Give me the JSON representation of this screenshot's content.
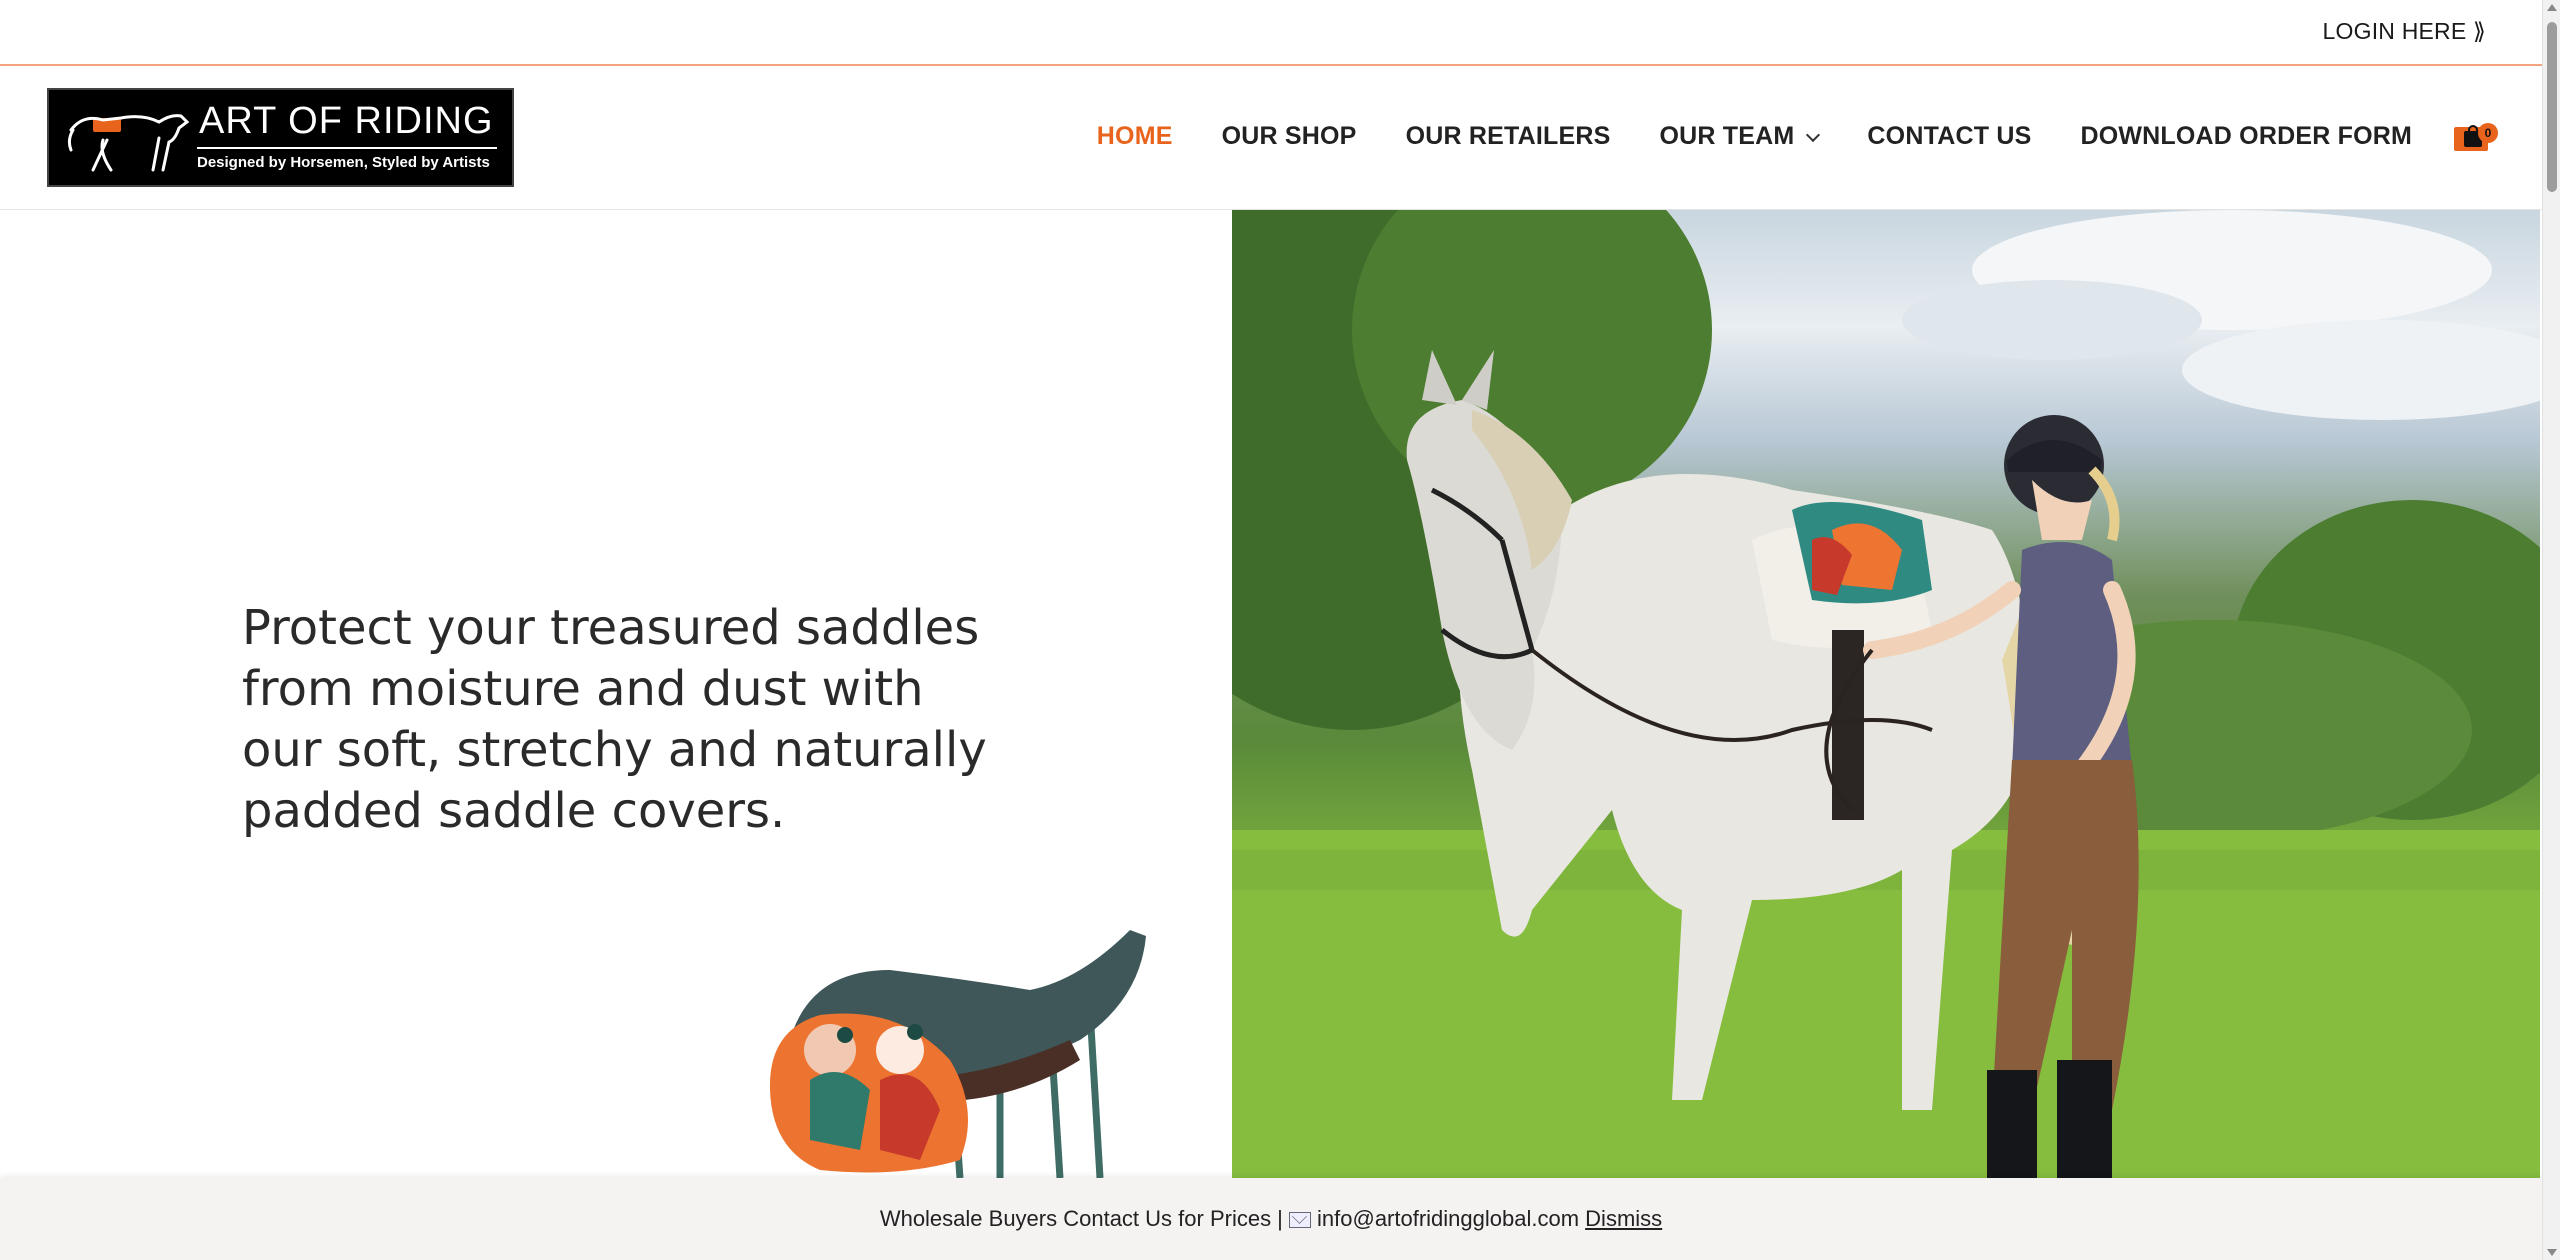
{
  "topbar": {
    "login_label": "LOGIN HERE ⟫"
  },
  "logo": {
    "title": "ART OF RIDING",
    "tagline": "Designed by Horsemen, Styled by Artists"
  },
  "nav": {
    "items": [
      {
        "label": "HOME",
        "active": true
      },
      {
        "label": "OUR SHOP",
        "active": false
      },
      {
        "label": "OUR RETAILERS",
        "active": false
      },
      {
        "label": "OUR TEAM",
        "active": false,
        "has_dropdown": true
      },
      {
        "label": "CONTACT US",
        "active": false
      },
      {
        "label": "DOWNLOAD ORDER FORM",
        "active": false
      }
    ]
  },
  "cart": {
    "icon": "shopping-bag-icon",
    "count": "0"
  },
  "hero": {
    "headline": "Protect your treasured saddles from moisture and dust with our soft, stretchy and naturally padded saddle covers.",
    "photo_icon": "rider-with-horse-photo",
    "product_icon": "saddle-with-cover-photo"
  },
  "notice": {
    "text_before": "Wholesale Buyers Contact Us for Prices | ",
    "email": "info@artofridingglobal.com",
    "dismiss_label": "Dismiss",
    "icon": "envelope-icon"
  },
  "colors": {
    "accent": "#e8641c",
    "logo_bg": "#000000",
    "notice_bg": "#f5f2f2"
  }
}
